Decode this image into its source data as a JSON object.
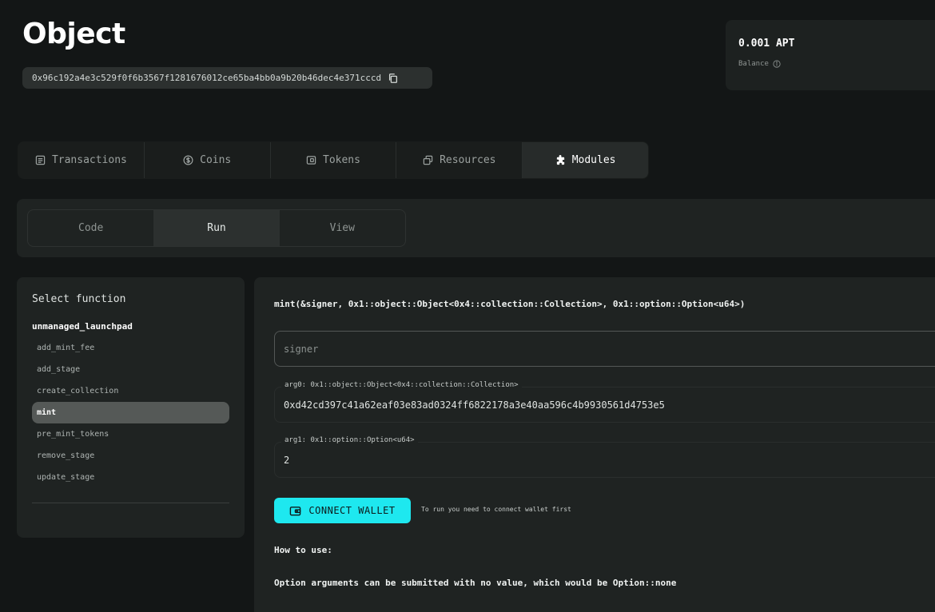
{
  "header": {
    "title": "Object",
    "address": "0x96c192a4e3c529f0f6b3567f1281676012ce65ba4bb0a9b20b46dec4e371cccd"
  },
  "balance": {
    "value": "0.001 APT",
    "label": "Balance"
  },
  "tabs": [
    {
      "label": "Transactions",
      "icon": "transactions-icon"
    },
    {
      "label": "Coins",
      "icon": "coin-icon"
    },
    {
      "label": "Tokens",
      "icon": "tokens-icon"
    },
    {
      "label": "Resources",
      "icon": "resources-icon"
    },
    {
      "label": "Modules",
      "icon": "puzzle-icon",
      "active": true
    }
  ],
  "subtabs": [
    {
      "label": "Code"
    },
    {
      "label": "Run",
      "active": true
    },
    {
      "label": "View"
    }
  ],
  "function_panel": {
    "title": "Select function",
    "module": "unmanaged_launchpad",
    "functions": [
      "add_mint_fee",
      "add_stage",
      "create_collection",
      "mint",
      "pre_mint_tokens",
      "remove_stage",
      "update_stage"
    ],
    "selected": "mint"
  },
  "run": {
    "signature": "mint(&signer, 0x1::object::Object<0x4::collection::Collection>, 0x1::option::Option<u64>)",
    "signer_placeholder": "signer",
    "arg0_label": "arg0: 0x1::object::Object<0x4::collection::Collection>",
    "arg0_value": "0xd42cd397c41a62eaf03e83ad0324ff6822178a3e40aa596c4b9930561d4753e5",
    "arg1_label": "arg1: 0x1::option::Option<u64>",
    "arg1_value": "2",
    "connect_label": "CONNECT WALLET",
    "connect_hint": "To run you need to connect wallet first",
    "howto_title": "How to use:",
    "howto_text": "Option arguments can be submitted with no value, which would be Option::none"
  },
  "colors": {
    "background": "#131616",
    "panel": "#1f2322",
    "accent": "#1ee8ef"
  }
}
